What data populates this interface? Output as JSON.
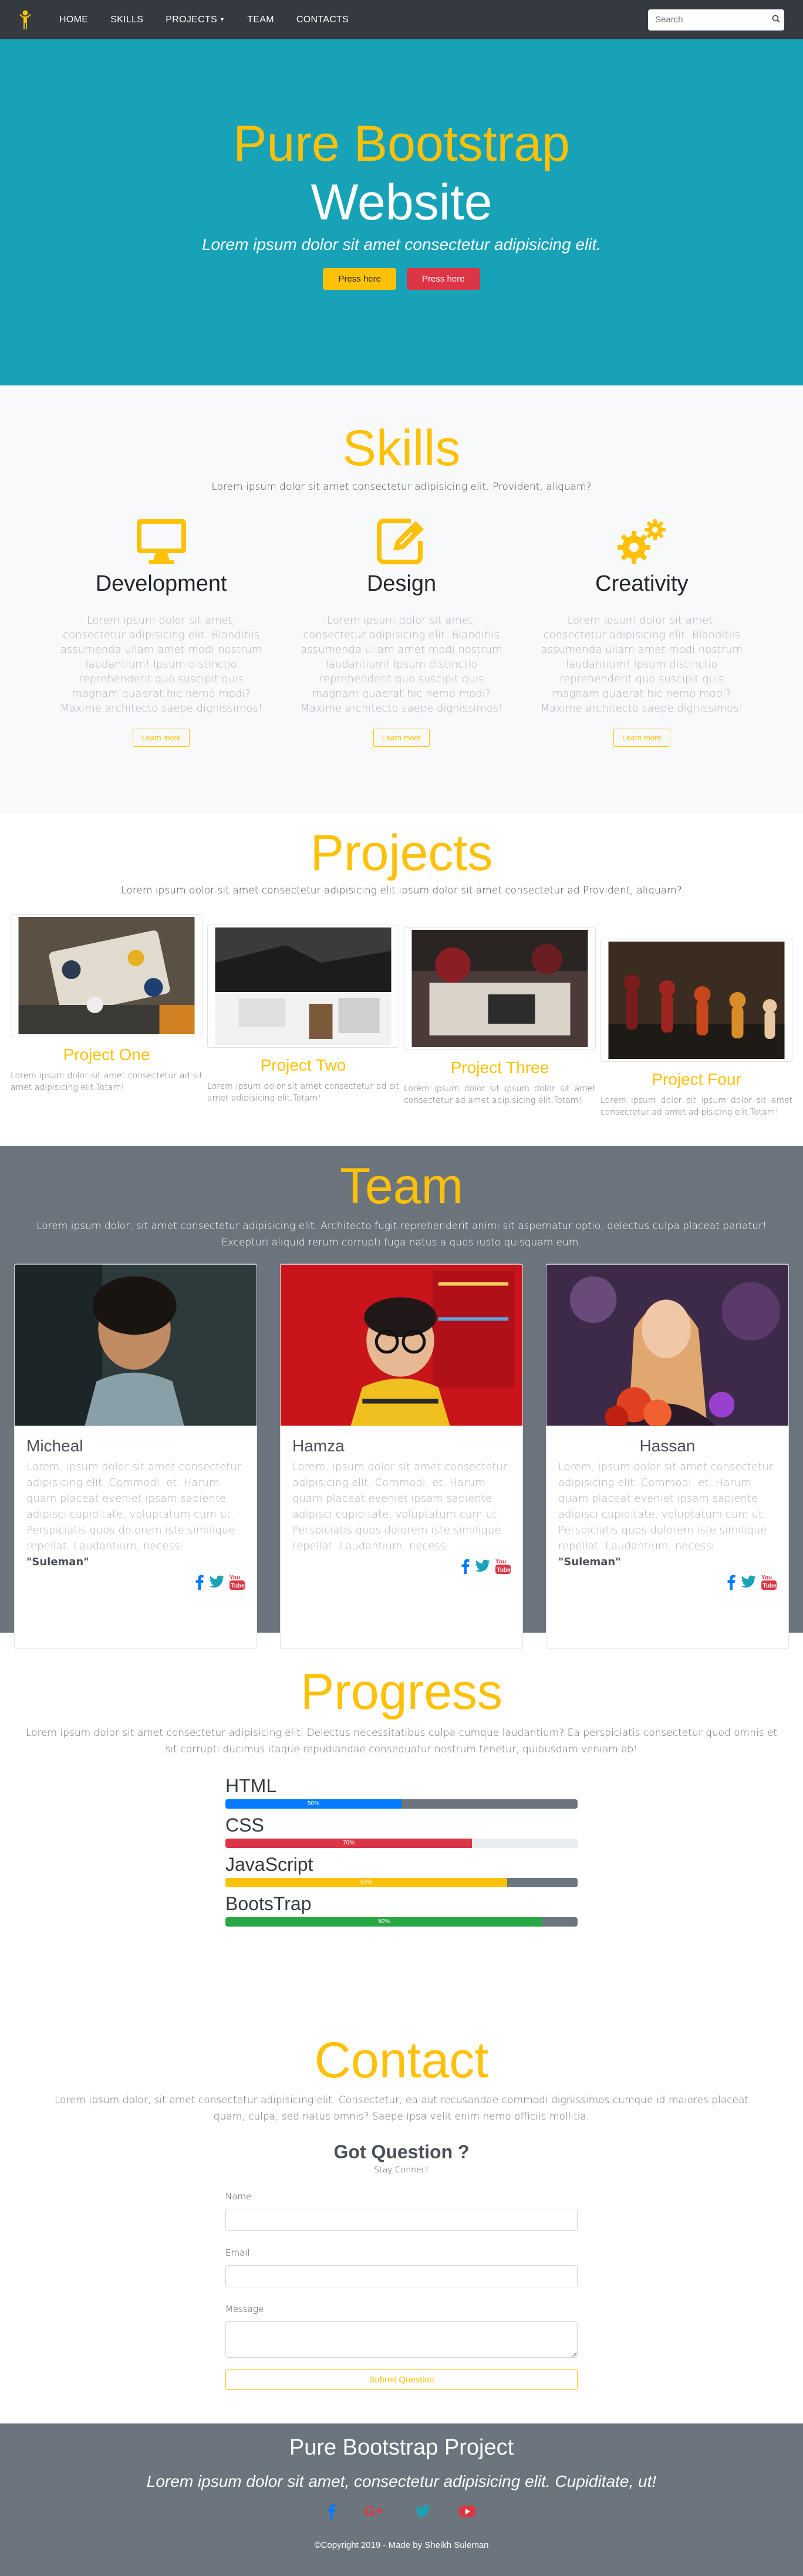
{
  "nav": {
    "logo_icon": "person-icon",
    "links": [
      "HOME",
      "SKILLS",
      "PROJECTS",
      "TEAM",
      "CONTACTS"
    ],
    "search_placeholder": "Search"
  },
  "hero": {
    "line1": "Pure Bootstrap",
    "line2": "Website",
    "subtitle": "Lorem ipsum dolor sit amet consectetur adipisicing elit.",
    "btn1": "Press here",
    "btn2": "Press here"
  },
  "skills": {
    "title": "Skills",
    "lead": "Lorem ipsum dolor sit amet consectetur adipisicing elit. Provident, aliquam?",
    "items": [
      {
        "icon": "desktop-icon",
        "title": "Development",
        "text": "Lorem ipsum dolor sit amet, consectetur adipisicing elit. Blanditiis assumenda ullam amet modi nostrum laudantium! Ipsum distinctio reprehenderit quo suscipit quis magnam quaerat hic nemo modi? Maxime architecto saepe dignissimos!",
        "button": "Learn more"
      },
      {
        "icon": "edit-icon",
        "title": "Design",
        "text": "Lorem ipsum dolor sit amet, consectetur adipisicing elit. Blanditiis assumenda ullam amet modi nostrum laudantium! Ipsum distinctio reprehenderit quo suscipit quis magnam quaerat hic nemo modi? Maxime architecto saepe dignissimos!",
        "button": "Learn more"
      },
      {
        "icon": "cogs-icon",
        "title": "Creativity",
        "text": "Lorem ipsum dolor sit amet, consectetur adipisicing elit. Blanditiis assumenda ullam amet modi nostrum laudantium! Ipsum distinctio reprehenderit quo suscipit quis magnam quaerat hic nemo modi? Maxime architecto saepe dignissimos!",
        "button": "Learn more"
      }
    ]
  },
  "projects": {
    "title": "Projects",
    "lead": "Lorem ipsum dolor sit amet consectetur adipisicing elit.ipsum dolor sit amet consectetur ad Provident, aliquam?",
    "items": [
      {
        "title": "Project One",
        "text": "Lorem ipsum dolor sit amet consectetur ad sit amet adipisicing elit.Totam!"
      },
      {
        "title": "Project Two",
        "text": "Lorem ipsum dolor sit amet consectetur ad sit amet adipisicing elit.Totam!"
      },
      {
        "title": "Project Three",
        "text": "Lorem ipsum dolor sit ipsum dolor sit amet consectetur ad amet adipisicing elit.Totam!"
      },
      {
        "title": "Project Four",
        "text": "Lorem ipsum dolor sit ipsum dolor sit amet consectetur ad amet adipisicing elit.Totam!"
      }
    ]
  },
  "team": {
    "title": "Team",
    "lead": "Lorem ipsum dolor, sit amet consectetur adipisicing elit. Architecto fugit reprehenderit animi sit aspernatur optio, delectus culpa placeat pariatur! Excepturi aliquid rerum corrupti fuga natus a quos iusto quisquam eum.",
    "members": [
      {
        "name": "Micheal",
        "text": "Lorem, ipsum dolor sit amet consectetur adipisicing elit. Commodi, et. Harum quam placeat eveniet ipsam sapiente adipisci cupiditate, voluptatum cum ut. Perspiciatis quos dolorem iste similique repellat. Laudantium, necessi.",
        "quote": "\"Suleman\""
      },
      {
        "name": "Hamza",
        "text": "Lorem, ipsum dolor sit amet consectetur adipisicing elit. Commodi, et. Harum quam placeat eveniet ipsam sapiente adipisci cupiditate, voluptatum cum ut. Perspiciatis quos dolorem iste similique repellat. Laudantium, necessi.",
        "quote": ""
      },
      {
        "name": "Hassan",
        "text": "Lorem, ipsum dolor sit amet consectetur adipisicing elit. Commodi, et. Harum quam placeat eveniet ipsam sapiente adipisci cupiditate, voluptatum cum ut. Perspiciatis quos dolorem iste similique repellat. Laudantium, necessi.",
        "quote": "\"Suleman\""
      }
    ]
  },
  "progress": {
    "title": "Progress",
    "lead": "Lorem ipsum dolor sit amet consectetur adipisicing elit. Delectus necessitatibus culpa cumque laudantium? Ea perspiciatis consectetur quod omnis et sit corrupti ducimus itaque repudiandae consequatur nostrum tenetur, quibusdam veniam ab!",
    "bars": [
      {
        "label": "HTML",
        "value": 50,
        "text": "50%",
        "color": "#007bff",
        "track": "dark"
      },
      {
        "label": "CSS",
        "value": 70,
        "text": "70%",
        "color": "#dc3545",
        "track": "light"
      },
      {
        "label": "JavaScript",
        "value": 80,
        "text": "80%",
        "color": "#ffc107",
        "track": "dark"
      },
      {
        "label": "BootsTrap",
        "value": 90,
        "text": "90%",
        "color": "#28a745",
        "track": "dark"
      }
    ]
  },
  "contact": {
    "title": "Contact",
    "lead": "Lorem ipsum dolor, sit amet consectetur adipisicing elit. Consectetur, ea aut recusandae commodi dignissimos cumque id maiores placeat quam, culpa, sed natus omnis? Saepe ipsa velit enim nemo officiis mollitia.",
    "heading": "Got Question ?",
    "sub": "Stay Connect",
    "name_label": "Name",
    "email_label": "Email",
    "message_label": "Message",
    "submit": "Submit Question"
  },
  "footer": {
    "title": "Pure Bootstrap Project",
    "tagline": "Lorem ipsum dolor sit amet, consectetur adipisicing elit. Cupiditate, ut!",
    "icons": [
      "facebook-icon",
      "google-plus-icon",
      "twitter-icon",
      "youtube-icon"
    ],
    "copyright": "©Copyright 2019 - Made by Sheikh Suleman"
  },
  "colors": {
    "accent": "#ffc107",
    "hero_bg": "#17a2b8",
    "dark": "#343a40",
    "gray": "#6c757d"
  }
}
